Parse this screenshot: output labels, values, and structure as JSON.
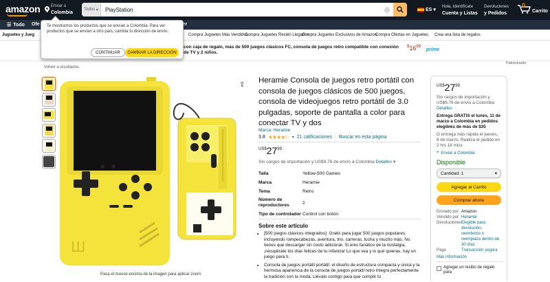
{
  "header": {
    "logo": "amazon",
    "deliver_line1": "Enviar a",
    "deliver_line2": "Colombia",
    "search_category": "Todos",
    "search_query": "PlayStation",
    "lang": "ES",
    "account_line1": "Hola, Identifícate",
    "account_line2": "Cuenta y Listas",
    "orders_line1": "Devoluciones",
    "orders_line2": "y Pedidos",
    "cart_count": "0",
    "cart_label": "Carrito"
  },
  "navbar": {
    "all": "Todo",
    "ofertas": "Ofe",
    "tender": "nder"
  },
  "subnav": [
    "Juguetes y Jueg",
    "Compra Juguetes Más Vendidos",
    "Compra Juguetes Recién Llegados",
    "Compra Juguetes Exclusivos de Amazon",
    "Compra Ofertas en Juguetes",
    "Crea una lista de regalos"
  ],
  "banner": {
    "text": "con caja de regalo, más de 500 juegos clásicos FC, consola de juegos retro compatible con conexión de TV y 2 niños.",
    "price_whole": "16",
    "price_frac": "99",
    "prime": "prime"
  },
  "popup": {
    "message": "Te mostramos los productos que se envían a Colombia. Para ver productos que se envían a otro país, cambia tu dirección de envío.",
    "continue": "CONTINUAR",
    "change": "CAMBIAR LA DIRECCIÓN"
  },
  "breadcrumb": {
    "back": "Volver a resultados",
    "sponsored": "Patrocinado"
  },
  "gallery": {
    "caption": "Pasa el mouse encima de la imagen para aplicar zoom"
  },
  "product": {
    "title": "Heramie Consola de juegos retro portátil con consola de juegos clásicos de 500 juegos, consola de videojuegos retro portátil de 3.0 pulgadas, soporte de pantalla a color para conectar TV y dos",
    "brand": "Marca: Heramie",
    "rating_value": "3.8",
    "rating_stars": "★★★★☆",
    "ratings_count": "21 calificaciones",
    "search_page": "Buscar en esta página",
    "price_currency": "US$",
    "price_whole": "27",
    "price_frac": "99",
    "shipping_text": "Sin cargos de importación y US$9.76 de envío a Colombia",
    "shipping_link": "Detalles",
    "specs": [
      {
        "k": "Talla",
        "v": "Yellow-500 Games"
      },
      {
        "k": "Marca",
        "v": "Heramie"
      },
      {
        "k": "Tema",
        "v": "Retro"
      },
      {
        "k": "Número de reproductores",
        "v": "2"
      },
      {
        "k": "Tipo de controlador",
        "v": "Control con botón"
      }
    ],
    "about_title": "Sobre este artículo",
    "bullets": [
      "[500 juegos clásicos integrados]: Gratis para jugar 500 juegos populares, incluyendo rompecabezas, aventura, tiro, carreras, lucha y mucho más. No tienes que descargar sin costo adicional. Si eres fanático de la nostalgia, ¡recupérate los días felices de tu infancia! Lo que sea y lo que quieras, hay un juego para ti.",
      "Consola de juegos portátil portátil: el diseño de estructura compacta y única y la hermosa apariencia de la consola de juegos portátil retro integra perfectamente la tradición con la moda. Llévalo contigo para que cumplir tu"
    ]
  },
  "buybox": {
    "currency": "US$",
    "price_whole": "27",
    "price_frac": "99",
    "import_text": "Sin cargos de importación y US$9.76 de envío a Colombia",
    "details": "Detalles",
    "delivery": "Entrega GRATIS el lunes, 11 de marzo a Colombia en pedidos elegibles de más de $35",
    "fastest": "O entrega más rápida el jueves, 8 de marzo. Realiza el pedido en 2 hrs 18 mins",
    "location": "Enviar a Colombia",
    "stock": "Disponible",
    "qty": "Cantidad: 1",
    "add_to_cart": "Agregar al Carrito",
    "buy_now": "Comprar ahora",
    "table": [
      {
        "k": "Enviado por",
        "v": "Amazon"
      },
      {
        "k": "Vendido por",
        "v": "Heramie"
      },
      {
        "k": "Devoluciones",
        "v": "Elegible para devolución, reembolso o reemplazo dentro de 30 días"
      },
      {
        "k": "Pago",
        "v": "Transacción segura"
      }
    ],
    "more_info": "Más información",
    "gift": "Agregar un recibo de regalo para"
  },
  "colors": {
    "topbar": "#131921",
    "navbar": "#232f3e",
    "accent": "#febd69",
    "add_cart": "#ffd814",
    "buy_now": "#ffa41c",
    "link": "#007185",
    "in_stock": "#007600",
    "console": "#f3e33b"
  }
}
